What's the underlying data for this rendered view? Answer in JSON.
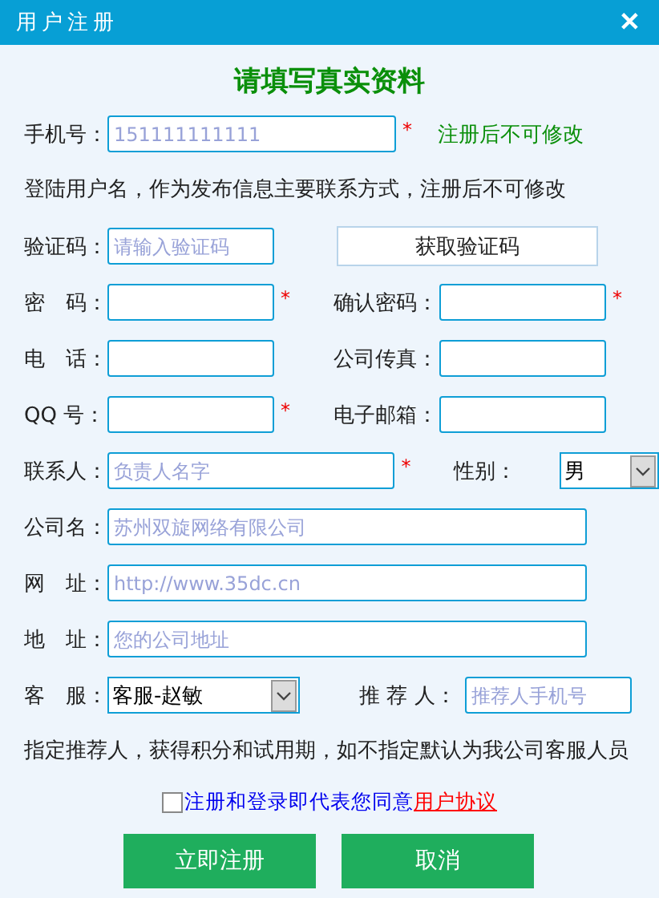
{
  "window": {
    "title": "用户注册",
    "close": "✕"
  },
  "heading": "请填写真实资料",
  "rows": [
    {
      "kind": "pair",
      "label": "手机号：",
      "field": {
        "kind": "input",
        "placeholder": "151111111111"
      },
      "required": true,
      "note": "注册后不可修改"
    },
    {
      "kind": "text",
      "text": "登陆用户名，作为发布信息主要联系方式，注册后不可修改"
    },
    {
      "kind": "pair",
      "label": "验证码：",
      "field": {
        "kind": "input",
        "placeholder": "请输入验证码"
      },
      "required": false,
      "button": "获取验证码"
    },
    {
      "kind": "pair",
      "label": "密　码：",
      "field": {
        "kind": "input"
      },
      "required": true,
      "right": {
        "label": "确认密码：",
        "field": {
          "kind": "input"
        },
        "required": true
      }
    },
    {
      "kind": "pair",
      "label": "电　话：",
      "field": {
        "kind": "input"
      },
      "required": false,
      "right": {
        "label": "公司传真：",
        "field": {
          "kind": "input"
        },
        "required": false
      }
    },
    {
      "kind": "pair",
      "label": "QQ 号：",
      "field": {
        "kind": "input"
      },
      "required": true,
      "right": {
        "label": "电子邮箱：",
        "field": {
          "kind": "input"
        },
        "required": false
      }
    },
    {
      "kind": "pair",
      "label": "联系人：",
      "field": {
        "kind": "input",
        "placeholder": "负责人名字"
      },
      "required": true,
      "right": {
        "label": "性别：",
        "field": {
          "kind": "select",
          "value": "男"
        },
        "required": false
      }
    },
    {
      "kind": "pair",
      "label": "公司名：",
      "field": {
        "kind": "input",
        "placeholder": "苏州双旋网络有限公司"
      },
      "required": false
    },
    {
      "kind": "pair",
      "label": "网　址：",
      "field": {
        "kind": "input",
        "placeholder": "http://www.35dc.cn"
      },
      "required": false
    },
    {
      "kind": "pair",
      "label": "地　址：",
      "field": {
        "kind": "input",
        "placeholder": "您的公司地址"
      },
      "required": false
    },
    {
      "kind": "pair",
      "label": "客　服：",
      "field": {
        "kind": "select",
        "value": "客服-赵敏"
      },
      "required": false,
      "right": {
        "label": "推 荐 人：",
        "field": {
          "kind": "input",
          "placeholder": "推荐人手机号"
        },
        "required": false
      }
    },
    {
      "kind": "text",
      "text": "指定推荐人，获得积分和试用期，如不指定默认为我公司客服人员"
    }
  ],
  "agree": {
    "checked": false,
    "text": "注册和登录即代表您同意",
    "link": "用户协议"
  },
  "buttons": [
    "立即注册",
    "取消"
  ],
  "required_mark": "*"
}
